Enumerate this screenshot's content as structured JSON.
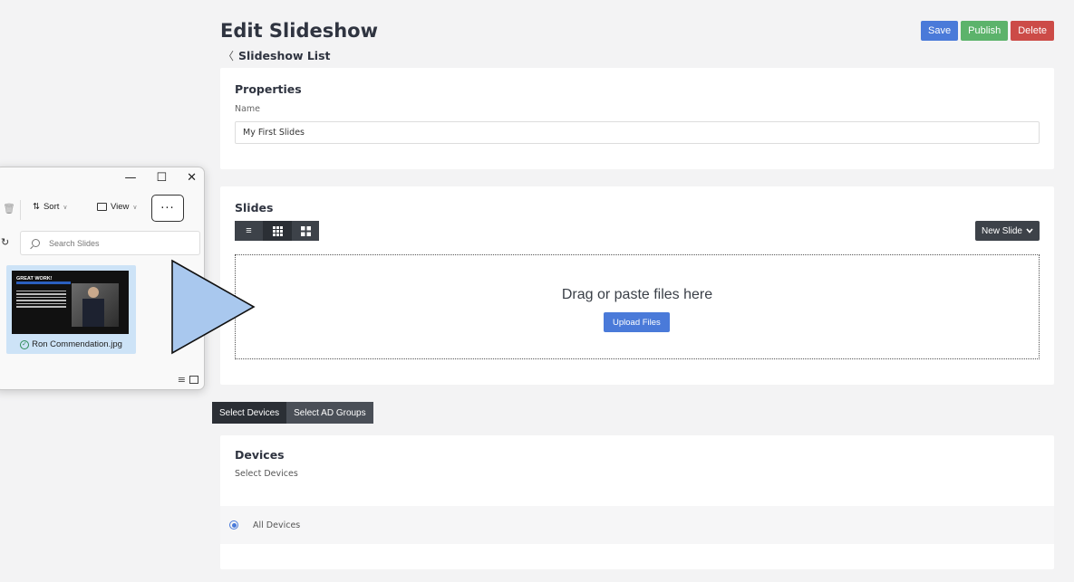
{
  "page": {
    "title": "Edit Slideshow",
    "back_link": "Slideshow List"
  },
  "actions": {
    "save": "Save",
    "publish": "Publish",
    "delete": "Delete"
  },
  "properties": {
    "heading": "Properties",
    "name_label": "Name",
    "name_value": "My First Slides"
  },
  "slides": {
    "heading": "Slides",
    "new_slide": "New Slide",
    "dropzone_text": "Drag or paste files here",
    "upload_button": "Upload Files"
  },
  "selectors": {
    "devices_tab": "Select Devices",
    "ad_groups_tab": "Select AD Groups"
  },
  "devices": {
    "heading": "Devices",
    "subheading": "Select Devices",
    "option_label": "All Devices"
  },
  "explorer": {
    "sort_label": "Sort",
    "view_label": "View",
    "more_label": "···",
    "search_placeholder": "Search Slides",
    "file_name": "Ron Commendation.jpg",
    "thumb_title": "GREAT WORK!",
    "minimize": "—",
    "maximize": "☐",
    "close": "✕"
  },
  "colors": {
    "primary": "#4a7ad9",
    "success": "#5cb36b",
    "danger": "#cc4b47",
    "dark": "#3d4249",
    "arrow_fill": "#a9c8ee"
  }
}
